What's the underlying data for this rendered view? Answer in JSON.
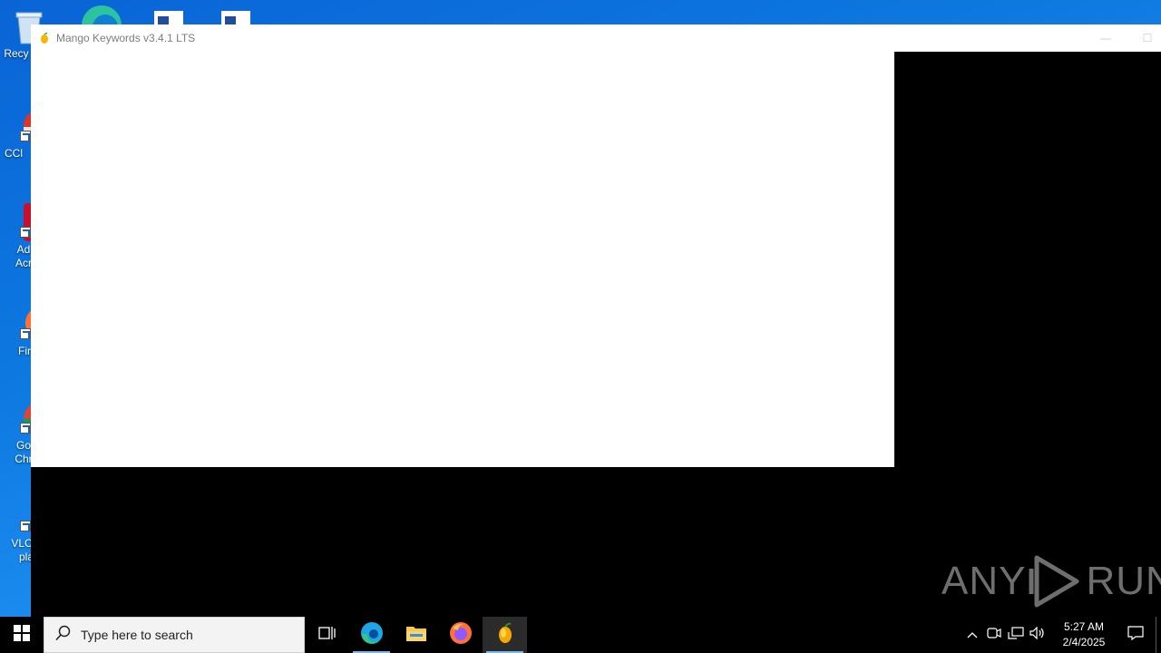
{
  "desktop": {
    "icons": [
      {
        "label": "Recy",
        "icon": "recycle-bin-icon"
      },
      {
        "label": "CCl",
        "icon": "ccleaner-icon"
      },
      {
        "label": "Ad",
        "label2": "Acr",
        "icon": "acrobat-icon"
      },
      {
        "label": "Fir",
        "icon": "firefox-icon"
      },
      {
        "label": "Go",
        "label2": "Chr",
        "icon": "chrome-icon"
      },
      {
        "label": "VLC",
        "label2": "pla",
        "icon": "vlc-icon"
      }
    ]
  },
  "window": {
    "title": "Mango Keywords v3.4.1 LTS",
    "icon": "mango-icon",
    "minimize_glyph": "—",
    "maximize_glyph": "☐"
  },
  "watermark": {
    "left": "ANY",
    "right": "RUN"
  },
  "taskbar": {
    "search_placeholder": "Type here to search",
    "apps": [
      {
        "name": "task-view",
        "icon": "task-view-icon"
      },
      {
        "name": "edge",
        "icon": "edge-icon"
      },
      {
        "name": "file-explorer",
        "icon": "folder-icon"
      },
      {
        "name": "firefox",
        "icon": "firefox-icon"
      },
      {
        "name": "mango-keywords",
        "icon": "mango-icon"
      }
    ],
    "clock": {
      "time": "5:27 AM",
      "date": "2/4/2025"
    }
  },
  "colors": {
    "desktop_blue": "#0d78e0",
    "taskbar": "#000000",
    "accent": "#76b9ed",
    "mango": "#f5b800"
  }
}
